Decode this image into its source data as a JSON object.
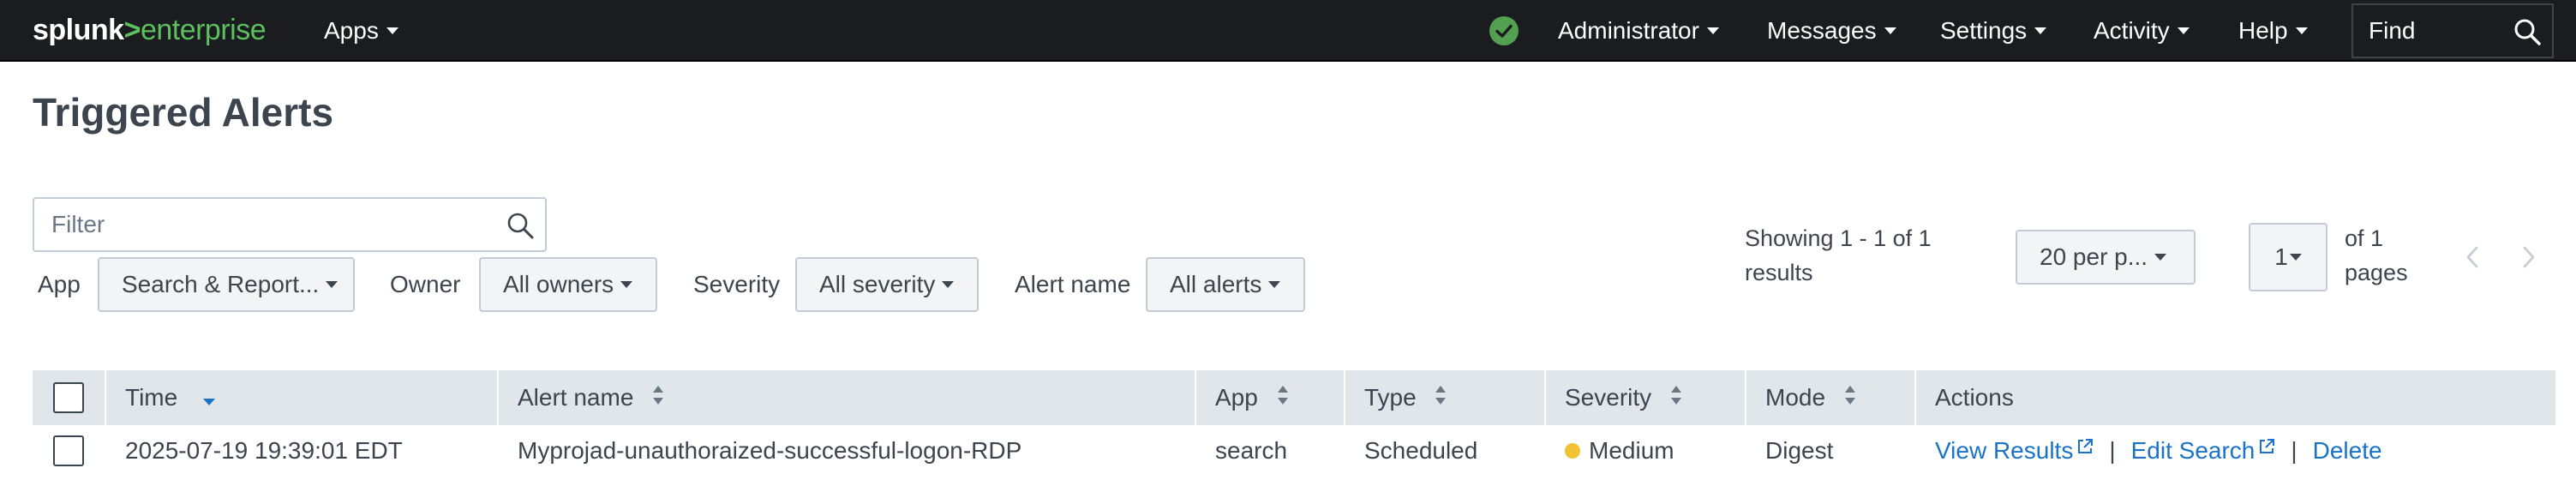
{
  "app": {
    "logo_part1": "splunk",
    "logo_part2": ">",
    "logo_part3": "enterprise",
    "apps_menu": "Apps",
    "status_icon": "check-circle-icon",
    "user_menu": "Administrator",
    "messages_menu": "Messages",
    "settings_menu": "Settings",
    "activity_menu": "Activity",
    "help_menu": "Help",
    "find_placeholder": "Find",
    "colors": {
      "topbar_bg": "#1a1c20",
      "brand_green": "#5cc05c",
      "link": "#1a73c8",
      "status_ok": "#53a051"
    }
  },
  "page": {
    "title": "Triggered Alerts"
  },
  "filters": {
    "filter_placeholder": "Filter",
    "app_label": "App",
    "app_value": "Search & Report...",
    "owner_label": "Owner",
    "owner_value": "All owners",
    "severity_label": "Severity",
    "severity_value": "All severity",
    "alert_name_label": "Alert name",
    "alert_name_value": "All alerts"
  },
  "pagination": {
    "showing_line1": "Showing 1 - 1 of 1",
    "showing_line2": "results",
    "per_page": "20 per p...",
    "current_page": "1",
    "of_pages_line1": "of 1",
    "of_pages_line2": "pages"
  },
  "table": {
    "columns": {
      "time": "Time",
      "alert_name": "Alert name",
      "app": "App",
      "type": "Type",
      "severity": "Severity",
      "mode": "Mode",
      "actions": "Actions"
    },
    "rows": [
      {
        "time": "2025-07-19 19:39:01 EDT",
        "alert_name": "Myprojad-unauthoraized-successful-logon-RDP",
        "app": "search",
        "type": "Scheduled",
        "severity": "Medium",
        "severity_color": "#f1c232",
        "mode": "Digest",
        "view_results": "View Results",
        "edit_search": "Edit Search",
        "delete": "Delete"
      }
    ]
  }
}
